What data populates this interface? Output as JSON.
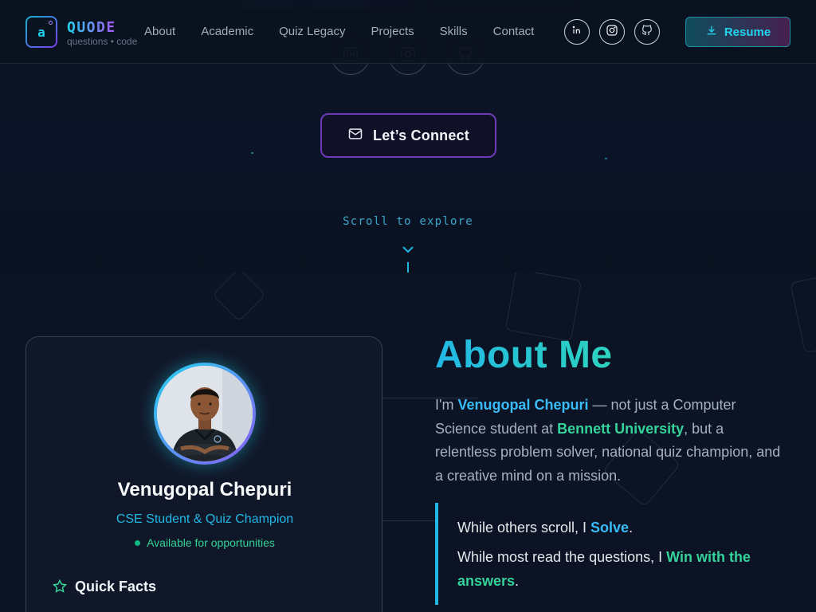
{
  "brand": {
    "logo_glyph": "a",
    "name": "QUODE",
    "tagline": "questions • code"
  },
  "nav": {
    "links": [
      {
        "label": "About"
      },
      {
        "label": "Academic"
      },
      {
        "label": "Quiz Legacy"
      },
      {
        "label": "Projects"
      },
      {
        "label": "Skills"
      },
      {
        "label": "Contact"
      }
    ],
    "social_icons": [
      "linkedin-icon",
      "instagram-icon",
      "github-icon"
    ],
    "resume_label": "Resume"
  },
  "hero": {
    "connect_label": "Let’s Connect",
    "scroll_label": "Scroll to explore",
    "social_icons": [
      "linkedin-icon",
      "instagram-icon",
      "github-icon"
    ]
  },
  "profile": {
    "name": "Venugopal Chepuri",
    "role": "CSE Student & Quiz Champion",
    "availability": "Available for opportunities",
    "quick_facts_title": "Quick Facts"
  },
  "about": {
    "title": "About Me",
    "intro_prefix": "I'm ",
    "intro_name": "Venugopal Chepuri",
    "intro_mid": " — not just a Computer Science student at ",
    "intro_university": "Bennett University",
    "intro_suffix": ", but a relentless problem solver, national quiz champion, and a creative mind on a mission.",
    "quote1_prefix": "While others scroll, I ",
    "quote1_highlight": "Solve",
    "quote1_suffix": ".",
    "quote2_prefix": "While most read the questions, I ",
    "quote2_highlight": "Win with the answers",
    "quote2_suffix": "."
  },
  "colors": {
    "accent_cyan": "#22d3ee",
    "accent_purple": "#8b5cf6",
    "accent_green": "#34d399",
    "background": "#0b1120"
  }
}
